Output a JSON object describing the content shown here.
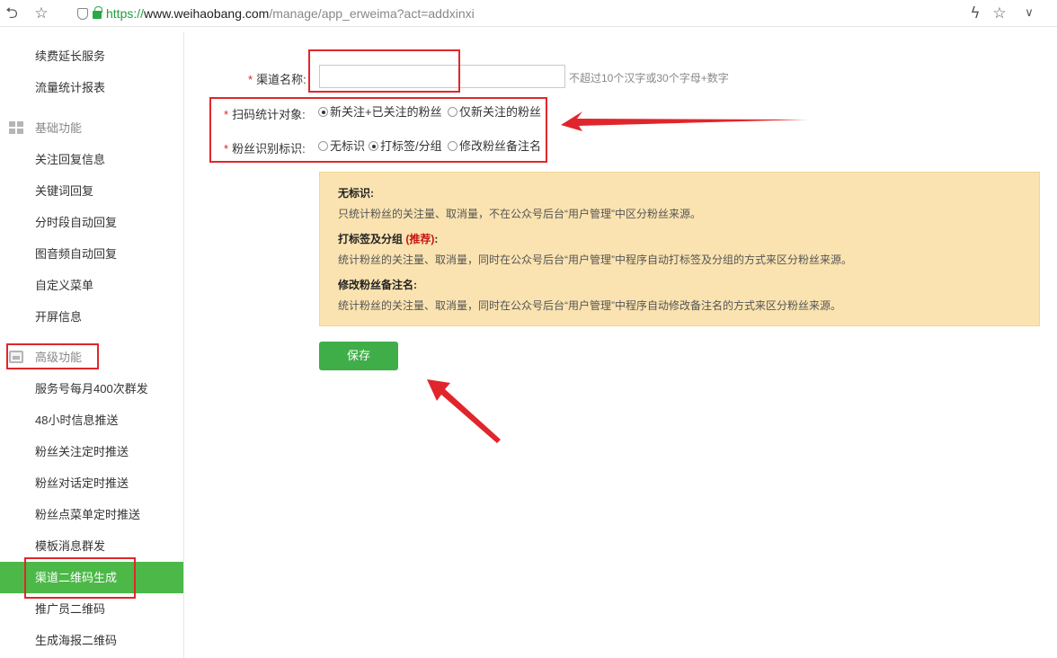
{
  "browser": {
    "url_scheme": "https://",
    "url_host": "www.weihaobang.com",
    "url_path": "/manage/app_erweima?act=addxinxi",
    "icons": [
      "back-icon",
      "bookmark-star-icon",
      "shield-icon",
      "lock-icon",
      "lightning-icon",
      "star-icon",
      "chevron-down-icon"
    ]
  },
  "sidebar": {
    "items_top": [
      "续费延长服务",
      "流量统计报表"
    ],
    "basic_section": "基础功能",
    "basic_items": [
      "关注回复信息",
      "关键词回复",
      "分时段自动回复",
      "图音频自动回复",
      "自定义菜单",
      "开屏信息"
    ],
    "advanced_section": "高级功能",
    "advanced_items": [
      "服务号每月400次群发",
      "48小时信息推送",
      "粉丝关注定时推送",
      "粉丝对话定时推送",
      "粉丝点菜单定时推送",
      "模板消息群发",
      "渠道二维码生成",
      "推广员二维码",
      "生成海报二维码"
    ],
    "active_item": "渠道二维码生成"
  },
  "form": {
    "required_mark": "*",
    "channel_name_label": "渠道名称:",
    "channel_name_value": "",
    "channel_name_hint": "不超过10个汉字或30个字母+数字",
    "scan_target_label": "扫码统计对象:",
    "scan_target_options": [
      "新关注+已关注的粉丝",
      "仅新关注的粉丝"
    ],
    "scan_target_selected": "新关注+已关注的粉丝",
    "fan_id_label": "粉丝识别标识:",
    "fan_id_options": [
      "无标识",
      "打标签/分组",
      "修改粉丝备注名"
    ],
    "fan_id_selected": "打标签/分组"
  },
  "info": {
    "no_tag_title": "无标识:",
    "no_tag_desc": "只统计粉丝的关注量、取消量，不在公众号后台“用户管理”中区分粉丝来源。",
    "tag_title": "打标签及分组",
    "tag_recommend": "(推荐)",
    "tag_colon": ":",
    "tag_desc": "统计粉丝的关注量、取消量，同时在公众号后台“用户管理”中程序自动打标签及分组的方式来区分粉丝来源。",
    "remark_title": "修改粉丝备注名:",
    "remark_desc": "统计粉丝的关注量、取消量，同时在公众号后台“用户管理”中程序自动修改备注名的方式来区分粉丝来源。"
  },
  "save_label": "保存",
  "colors": {
    "accent_green": "#4cb848",
    "button_green": "#3fae49",
    "required_red": "#e02020",
    "info_bg": "#fae3b0",
    "annotation_red": "#e0262c"
  }
}
